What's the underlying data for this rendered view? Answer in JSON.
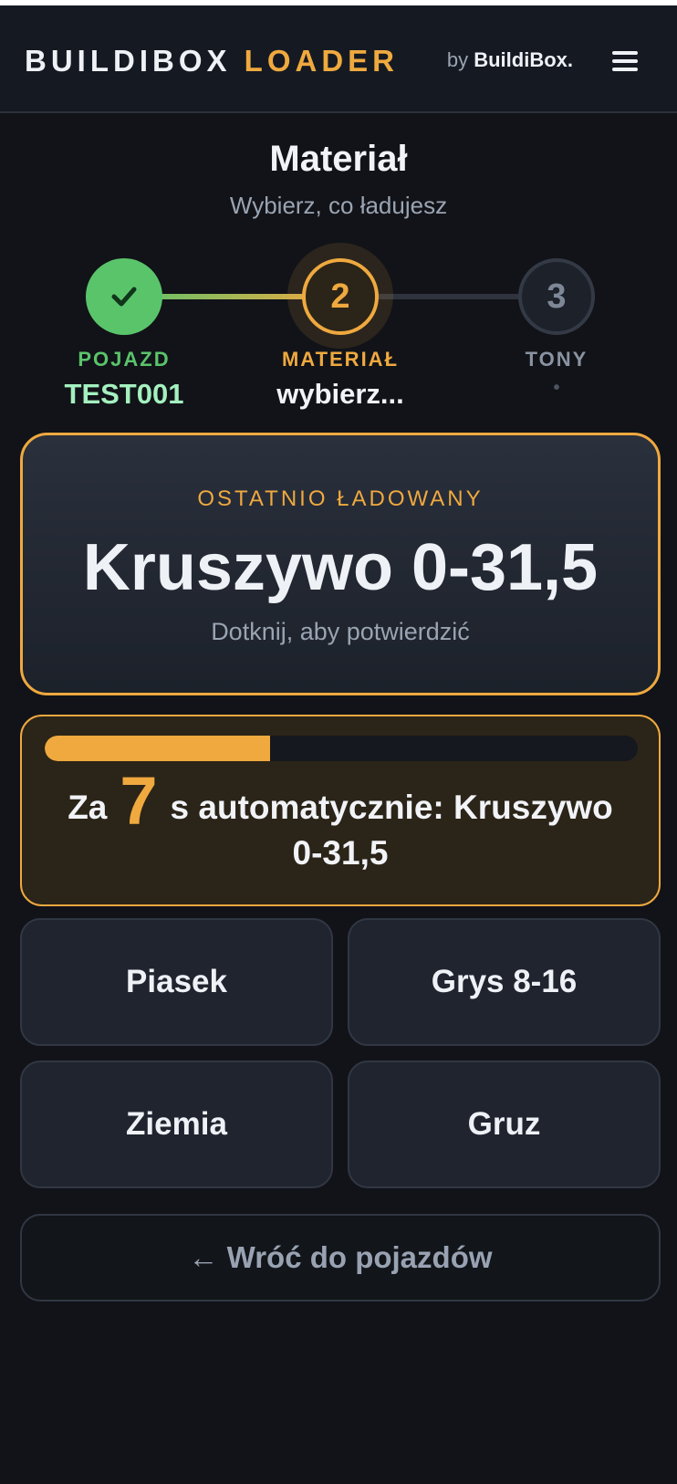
{
  "header": {
    "brand_part1": "BUILDIBOX",
    "brand_part2": "LOADER",
    "by_text": "by",
    "by_brand": "BuildiBox."
  },
  "page": {
    "title": "Materiał",
    "subtitle": "Wybierz, co ładujesz"
  },
  "steps": [
    {
      "number": "✓",
      "label": "POJAZD",
      "value": "TEST001",
      "state": "done"
    },
    {
      "number": "2",
      "label": "MATERIAŁ",
      "value": "wybierz...",
      "state": "active"
    },
    {
      "number": "3",
      "label": "TONY",
      "value": "•",
      "state": "pending"
    }
  ],
  "last_loaded": {
    "label": "OSTATNIO ŁADOWANY",
    "material": "Kruszywo 0-31,5",
    "hint": "Dotknij, aby potwierdzić"
  },
  "auto_timer": {
    "prefix": "Za",
    "seconds": "7",
    "suffix": "s automatycznie: Kruszywo 0-31,5",
    "progress": 0.38
  },
  "materials": [
    "Piasek",
    "Grys 8-16",
    "Ziemia",
    "Gruz"
  ],
  "back_button": "← Wróć do pojazdów",
  "colors": {
    "accent": "#efa93f",
    "success": "#5ac46b",
    "background": "#111318"
  }
}
